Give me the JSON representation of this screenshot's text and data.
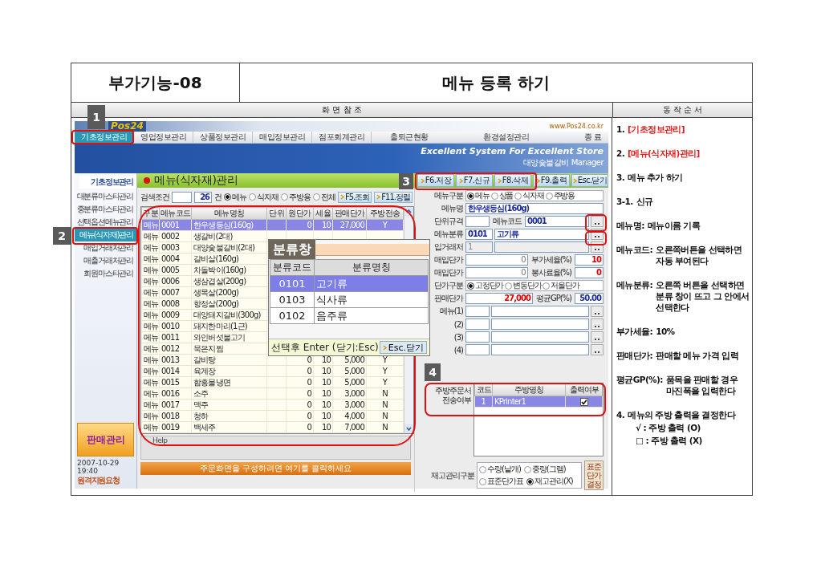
{
  "header": {
    "code": "부가기능-08",
    "title": "메뉴 등록 하기"
  },
  "section_headers": [
    "화 면 참 조",
    "동 작 순 서"
  ],
  "app": {
    "logo": "Pos24",
    "url": "www.Pos24.co.kr",
    "menu": [
      {
        "label": "기초정보관리",
        "selected": true
      },
      {
        "label": "영업정보관리",
        "selected": false
      },
      {
        "label": "상품정보관리",
        "selected": false
      },
      {
        "label": "매입정보관리",
        "selected": false
      },
      {
        "label": "점포회계관리",
        "selected": false
      }
    ],
    "menu_right": [
      {
        "label": "출퇴근현황",
        "selected": false
      },
      {
        "label": "환경설정관리",
        "selected": false
      },
      {
        "label": "종 료",
        "selected": false
      }
    ],
    "slogan": "Excellent System For Excellent Store",
    "manager": "대양숯불갈비 Manager",
    "sidebar": {
      "title": "기초정보관리",
      "items": [
        {
          "label": "대분류마스타관리",
          "selected": false
        },
        {
          "label": "중분류마스타관리",
          "selected": false
        },
        {
          "label": "선택옵션메뉴관리",
          "selected": false
        },
        {
          "label": "메뉴(식자재)관리",
          "selected": true
        },
        {
          "label": "매입거래처관리",
          "selected": false
        },
        {
          "label": "매출거래처관리",
          "selected": false
        },
        {
          "label": "회원마스타관리",
          "selected": false
        }
      ],
      "sales_button": "판매관리",
      "datetime": "2007-10-29 19:40",
      "remote_support": "원격지원요청"
    },
    "page_title": "메뉴(식자재)관리",
    "toolbar": [
      "F6.저장",
      "F7.신규",
      "F8.삭제",
      "F9.출력",
      "Esc.닫기"
    ],
    "search": {
      "label": "검색조건",
      "count": "26",
      "count_unit": "건",
      "filters": [
        {
          "label": "메뉴",
          "selected": true
        },
        {
          "label": "식자재",
          "selected": false
        },
        {
          "label": "주방용",
          "selected": false
        },
        {
          "label": "전체",
          "selected": false
        }
      ],
      "buttons": [
        "F5.조회",
        "F11.정렬"
      ]
    },
    "table": {
      "columns": [
        "구분",
        "메뉴코드",
        "메뉴명칭",
        "단위",
        "원단가",
        "세율",
        "판매단가",
        "주방전송"
      ],
      "rows": [
        {
          "type": "메뉴",
          "code": "0001",
          "name": "한우생등심(160g)",
          "cost": "0",
          "tax": "10",
          "price": "27,000",
          "kitchen": "Y",
          "selected": true
        },
        {
          "type": "메뉴",
          "code": "0002",
          "name": "생갈비(2대)",
          "selected": false
        },
        {
          "type": "메뉴",
          "code": "0003",
          "name": "대양숯불갈비(2대)",
          "selected": false
        },
        {
          "type": "메뉴",
          "code": "0004",
          "name": "갈비살(160g)",
          "selected": false
        },
        {
          "type": "메뉴",
          "code": "0005",
          "name": "차돌박이(160g)",
          "selected": false
        },
        {
          "type": "메뉴",
          "code": "0006",
          "name": "생삼겹살(200g)",
          "selected": false
        },
        {
          "type": "메뉴",
          "code": "0007",
          "name": "생목살(200g)",
          "selected": false
        },
        {
          "type": "메뉴",
          "code": "0008",
          "name": "항정살(200g)",
          "selected": false
        },
        {
          "type": "메뉴",
          "code": "0009",
          "name": "대양돼지갈비(300g)",
          "selected": false
        },
        {
          "type": "메뉴",
          "code": "0010",
          "name": "돼지한마리(1근)",
          "selected": false
        },
        {
          "type": "메뉴",
          "code": "0011",
          "name": "와인버섯불고기",
          "selected": false
        },
        {
          "type": "메뉴",
          "code": "0012",
          "name": "묵은지찜",
          "selected": false
        },
        {
          "type": "메뉴",
          "code": "0013",
          "name": "갈비탕",
          "cost": "0",
          "tax": "10",
          "price": "5,000",
          "kitchen": "Y",
          "selected": false
        },
        {
          "type": "메뉴",
          "code": "0014",
          "name": "육계장",
          "cost": "0",
          "tax": "10",
          "price": "5,000",
          "kitchen": "Y",
          "selected": false
        },
        {
          "type": "메뉴",
          "code": "0015",
          "name": "함흥물냉면",
          "cost": "0",
          "tax": "10",
          "price": "5,000",
          "kitchen": "Y",
          "selected": false
        },
        {
          "type": "메뉴",
          "code": "0016",
          "name": "소주",
          "cost": "0",
          "tax": "10",
          "price": "3,000",
          "kitchen": "N",
          "selected": false
        },
        {
          "type": "메뉴",
          "code": "0017",
          "name": "맥주",
          "cost": "0",
          "tax": "10",
          "price": "3,000",
          "kitchen": "N",
          "selected": false
        },
        {
          "type": "메뉴",
          "code": "0018",
          "name": "청하",
          "cost": "0",
          "tax": "10",
          "price": "4,000",
          "kitchen": "N",
          "selected": false
        },
        {
          "type": "메뉴",
          "code": "0019",
          "name": "백세주",
          "cost": "0",
          "tax": "10",
          "price": "7,000",
          "kitchen": "N",
          "selected": false
        }
      ]
    },
    "help_label": "Help",
    "order_bar": "주문화면을 구성하려면 여기를 클릭하세요",
    "form": {
      "rows": [
        {
          "kind": "radios",
          "label": "메뉴구분",
          "options": [
            {
              "label": "메뉴",
              "selected": true
            },
            {
              "label": "상품",
              "selected": false
            },
            {
              "label": "식자재",
              "selected": false
            },
            {
              "label": "주방용",
              "selected": false
            }
          ]
        },
        {
          "kind": "text",
          "label": "메뉴명",
          "value": "한우생등심(160g)"
        },
        {
          "kind": "unit_code",
          "label": "단위규격",
          "label2": "메뉴코드",
          "value2": "0001"
        },
        {
          "kind": "code_name",
          "label": "메뉴분류",
          "code": "0101",
          "name": "고기류",
          "disabled": false
        },
        {
          "kind": "code_name",
          "label": "입거래처",
          "code": "1",
          "disabled": true
        },
        {
          "kind": "pair",
          "label": "매입단가",
          "value": {
            "text": "0",
            "kind": "readonly"
          },
          "label2": "부가세율(%)",
          "value2": {
            "text": "10",
            "kind": "input"
          }
        },
        {
          "kind": "pair",
          "label": "매입단가",
          "value": {
            "text": "0",
            "kind": "readonly"
          },
          "label2": "봉사료율(%)",
          "value2": {
            "text": "0",
            "kind": "input"
          }
        },
        {
          "kind": "radios",
          "label": "단가구분",
          "options": [
            {
              "label": "고정단가",
              "selected": true
            },
            {
              "label": "변동단가",
              "selected": false
            },
            {
              "label": "저울단가",
              "selected": false
            }
          ]
        },
        {
          "kind": "pair",
          "label": "판매단가",
          "value": {
            "text": "27,000",
            "kind": "input"
          },
          "label2": "평균GP(%)",
          "value2": {
            "text": "50.00",
            "kind": "computed"
          }
        },
        {
          "kind": "set",
          "label": "메뉴(1)"
        },
        {
          "kind": "set",
          "label": "(2)"
        },
        {
          "kind": "set",
          "label": "(3)"
        },
        {
          "kind": "set",
          "label": "(4)"
        }
      ],
      "kitchen": {
        "label": "주방주문서 전송여부",
        "columns": [
          "코드",
          "주방명칭",
          "출력여부"
        ],
        "rows": [
          {
            "code": "1",
            "name": "KPrinter1",
            "print": true,
            "selected": true
          }
        ]
      },
      "stock": {
        "label": "재고관리구분",
        "options_row1": [
          {
            "label": "수량(낱개)",
            "selected": false
          },
          {
            "label": "중량(그램)",
            "selected": false
          }
        ],
        "options_row2": [
          {
            "label": "표준단가표",
            "selected": false
          },
          {
            "label": "재고관리(X)",
            "selected": true
          }
        ],
        "button": "표준단가결정"
      }
    },
    "popup": {
      "title": "분류창",
      "columns": [
        "분류코드",
        "분류명칭"
      ],
      "rows": [
        {
          "code": "0101",
          "name": "고기류",
          "selected": true
        },
        {
          "code": "0103",
          "name": "식사류",
          "selected": false
        },
        {
          "code": "0102",
          "name": "음주류",
          "selected": false
        }
      ],
      "hint": "선택후 Enter (닫기:Esc)",
      "close": "Esc.닫기"
    },
    "badges": [
      "1",
      "2",
      "3",
      "4"
    ]
  },
  "steps": [
    {
      "label": "1.",
      "text": "[기초정보관리]",
      "highlight": true
    },
    {
      "label": "2.",
      "text": "[메뉴(식자재)관리]",
      "highlight": true
    },
    {
      "label": "3.",
      "text": "메뉴 추가 하기",
      "highlight": false
    },
    {
      "label": "3-1.",
      "text": "신규",
      "highlight": false
    },
    {
      "label": "메뉴명:",
      "text": "메뉴이름 기록",
      "highlight": false
    },
    {
      "label": "메뉴코드:",
      "text": "오른쪽버튼을 선택하면 자동 부여된다",
      "highlight": false
    },
    {
      "label": "메뉴분류:",
      "text": "오른쪽 버튼을 선택하면 분류 창이 뜨고 그 안에서 선택한다",
      "highlight": false
    },
    {
      "label": "부가세율:",
      "text": "10%",
      "highlight": false
    },
    {
      "label": "판매단가:",
      "text": "판매할 메뉴 가격 입력",
      "highlight": false
    },
    {
      "label": "평균GP(%):",
      "text": "품목을 판매할 경우 마진폭을 입력한다",
      "highlight": false
    },
    {
      "label": "4.",
      "text": "메뉴의 주방 출력을 결정한다",
      "highlight": false,
      "sub": [
        "√ : 주방 출력 (O)",
        "□ : 주방 출력 (X)"
      ]
    }
  ]
}
